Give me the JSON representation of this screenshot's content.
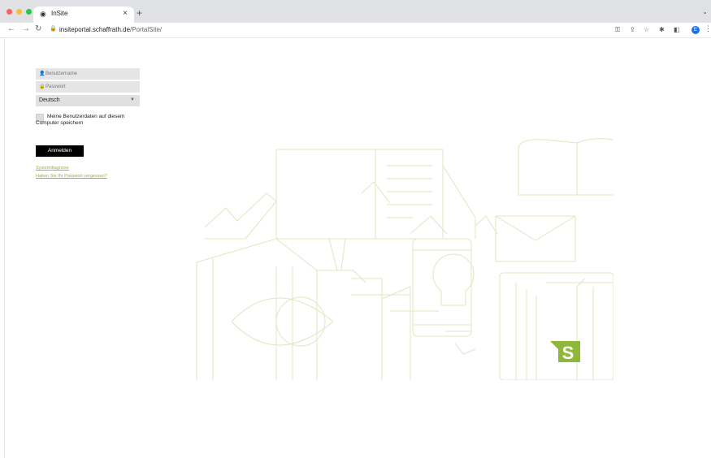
{
  "browser": {
    "tab_title": "InSite",
    "tab_close": "×",
    "new_tab": "+",
    "url_host": "insiteportal.schaffrath.de",
    "url_path": "/PortalSite/",
    "avatar_letter": "E",
    "colors": {
      "close": "#ff5f57",
      "minimize": "#febc2e",
      "maximize": "#28c840"
    }
  },
  "login": {
    "username_placeholder": "Benutzername",
    "password_placeholder": "Passwort",
    "language": "Deutsch",
    "remember_line1": "Meine Benutzerdaten auf diesem",
    "remember_line2": "Computer speichern",
    "submit": "Anmelden",
    "link_diagnose": "Systemdiagnose",
    "link_forgot": "Haben Sie Ihr Passwort vergessen?",
    "accent_color": "#8fb83a"
  },
  "logo": {
    "letter": "S",
    "color": "#8fb83a"
  }
}
